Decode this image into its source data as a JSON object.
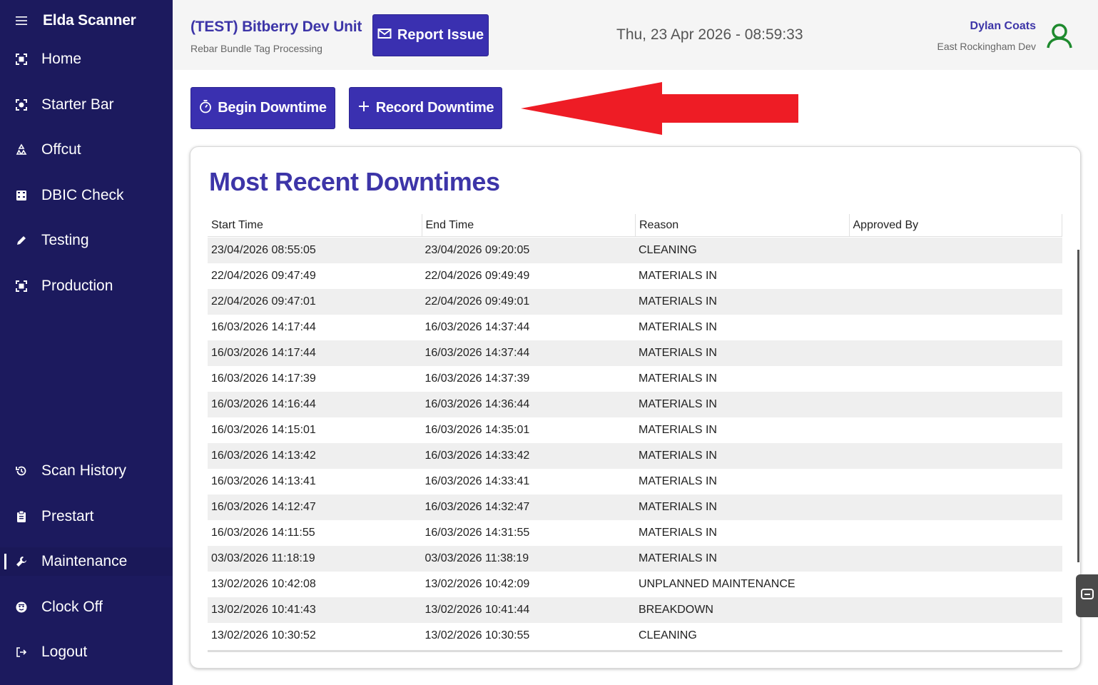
{
  "sidebar": {
    "app_title": "Elda Scanner",
    "items": [
      {
        "label": "Home",
        "icon": "scan-frame-icon"
      },
      {
        "label": "Starter Bar",
        "icon": "scan-target-icon"
      },
      {
        "label": "Offcut",
        "icon": "recycle-icon"
      },
      {
        "label": "DBIC Check",
        "icon": "calculator-icon"
      },
      {
        "label": "Testing",
        "icon": "pencil-icon"
      },
      {
        "label": "Production",
        "icon": "scan-frame-icon"
      },
      {
        "label": "Scan History",
        "icon": "history-icon"
      },
      {
        "label": "Prestart",
        "icon": "clipboard-icon"
      },
      {
        "label": "Maintenance",
        "icon": "wrench-icon",
        "active": true
      },
      {
        "label": "Clock Off",
        "icon": "face-icon"
      },
      {
        "label": "Logout",
        "icon": "logout-icon"
      }
    ]
  },
  "header": {
    "unit_title": "(TEST) Bitberry Dev Unit",
    "unit_subtitle": "Rebar Bundle Tag Processing",
    "report_label": "Report Issue",
    "clock": "Thu, 23 Apr 2026 - 08:59:33",
    "user_name": "Dylan Coats",
    "user_site": "East Rockingham Dev"
  },
  "actions": {
    "begin_label": "Begin Downtime",
    "record_label": "Record Downtime"
  },
  "downtimes": {
    "title": "Most Recent Downtimes",
    "columns": [
      "Start Time",
      "End Time",
      "Reason",
      "Approved By"
    ],
    "rows": [
      [
        "23/04/2026 08:55:05",
        "23/04/2026 09:20:05",
        "CLEANING",
        ""
      ],
      [
        "22/04/2026 09:47:49",
        "22/04/2026 09:49:49",
        "MATERIALS IN",
        ""
      ],
      [
        "22/04/2026 09:47:01",
        "22/04/2026 09:49:01",
        "MATERIALS IN",
        ""
      ],
      [
        "16/03/2026 14:17:44",
        "16/03/2026 14:37:44",
        "MATERIALS IN",
        ""
      ],
      [
        "16/03/2026 14:17:44",
        "16/03/2026 14:37:44",
        "MATERIALS IN",
        ""
      ],
      [
        "16/03/2026 14:17:39",
        "16/03/2026 14:37:39",
        "MATERIALS IN",
        ""
      ],
      [
        "16/03/2026 14:16:44",
        "16/03/2026 14:36:44",
        "MATERIALS IN",
        ""
      ],
      [
        "16/03/2026 14:15:01",
        "16/03/2026 14:35:01",
        "MATERIALS IN",
        ""
      ],
      [
        "16/03/2026 14:13:42",
        "16/03/2026 14:33:42",
        "MATERIALS IN",
        ""
      ],
      [
        "16/03/2026 14:13:41",
        "16/03/2026 14:33:41",
        "MATERIALS IN",
        ""
      ],
      [
        "16/03/2026 14:12:47",
        "16/03/2026 14:32:47",
        "MATERIALS IN",
        ""
      ],
      [
        "16/03/2026 14:11:55",
        "16/03/2026 14:31:55",
        "MATERIALS IN",
        ""
      ],
      [
        "03/03/2026 11:18:19",
        "03/03/2026 11:38:19",
        "MATERIALS IN",
        ""
      ],
      [
        "13/02/2026 10:42:08",
        "13/02/2026 10:42:09",
        "UNPLANNED MAINTENANCE",
        ""
      ],
      [
        "13/02/2026 10:41:43",
        "13/02/2026 10:41:44",
        "BREAKDOWN",
        ""
      ],
      [
        "13/02/2026 10:30:52",
        "13/02/2026 10:30:55",
        "CLEANING",
        ""
      ]
    ]
  },
  "colors": {
    "sidebar_bg": "#1c1a5e",
    "primary": "#3a30b0",
    "title_text": "#3d35a8",
    "avatar": "#1e8a2e",
    "annotation_arrow": "#ee1c25"
  }
}
